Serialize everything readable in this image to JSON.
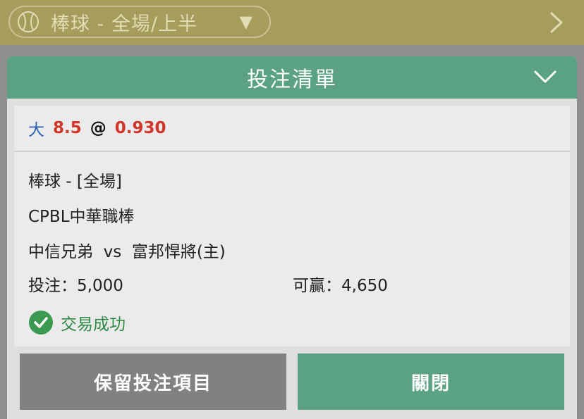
{
  "header": {
    "sport_selector": "棒球 - 全場/上半",
    "dropdown_glyph": "▼"
  },
  "panel": {
    "title": "投注清單"
  },
  "ticket": {
    "selection": "大",
    "line": "8.5",
    "at": "@",
    "odds": "0.930",
    "market": "棒球 - [全場]",
    "league": "CPBL中華職棒",
    "match": "中信兄弟  vs  富邦悍將(主)",
    "stake": "投注：5,000",
    "payout": "可贏：4,650",
    "status": "交易成功"
  },
  "buttons": {
    "keep": "保留投注項目",
    "close": "關閉"
  },
  "colors": {
    "topbar": "#a69d5c",
    "header_green": "#5aa283",
    "odds_red": "#d0362a",
    "selection_blue": "#2e62b8",
    "success_green": "#2e8a45",
    "keep_gray": "#818181"
  },
  "icons": {
    "sport": "baseball-icon",
    "dropdown": "dropdown-triangle-icon",
    "next": "chevron-right-icon",
    "collapse": "chevron-down-icon",
    "status": "check-circle-icon"
  }
}
